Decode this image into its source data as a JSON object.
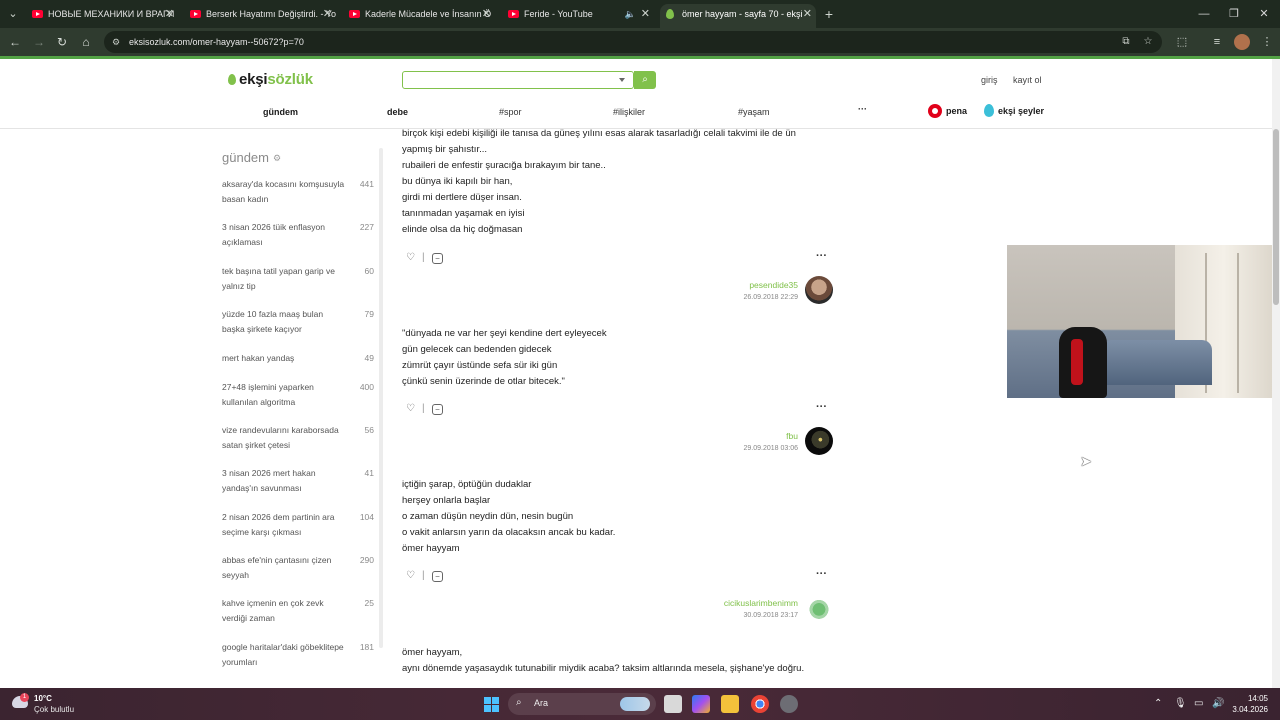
{
  "browser": {
    "tabs": [
      {
        "title": "НОВЫЕ МЕХАНИКИ И ВРАГИ",
        "favicon": "youtube-icon",
        "active": false
      },
      {
        "title": "Berserk Hayatımı Değiştirdi. - Yo",
        "favicon": "youtube-icon",
        "active": false
      },
      {
        "title": "Kaderle Mücadele ve İnsanın Ö",
        "favicon": "youtube-icon",
        "active": false
      },
      {
        "title": "Feride - YouTube",
        "favicon": "youtube-icon",
        "active": false
      },
      {
        "title": "ömer hayyam - sayfa 70 - ekşi",
        "favicon": "eksi-drop-icon",
        "active": true
      }
    ],
    "url": "eksisozluk.com/omer-hayyam--50672?p=70"
  },
  "site": {
    "logo_part1": "ekşi",
    "logo_part2": "sözlük",
    "search_placeholder": "",
    "login": "giriş",
    "register": "kayıt ol",
    "nav": [
      "gündem",
      "debe",
      "#spor",
      "#ilişkiler",
      "#yaşam",
      "···"
    ],
    "pena": "pena",
    "eksi_seyler": "ekşi şeyler",
    "accent_color": "#81c14b"
  },
  "sidebar": {
    "title": "gündem",
    "topics": [
      {
        "title": "aksaray'da kocasını komşusuyla basan kadın",
        "count": "441"
      },
      {
        "title": "3 nisan 2026 tüik enflasyon açıklaması",
        "count": "227"
      },
      {
        "title": "tek başına tatil yapan garip ve yalnız tip",
        "count": "60"
      },
      {
        "title": "yüzde 10 fazla maaş bulan başka şirkete kaçıyor",
        "count": "79"
      },
      {
        "title": "mert hakan yandaş",
        "count": "49"
      },
      {
        "title": "27+48 işlemini yaparken kullanılan algoritma",
        "count": "400"
      },
      {
        "title": "vize randevularını karaborsada satan şirket çetesi",
        "count": "56"
      },
      {
        "title": "3 nisan 2026 mert hakan yandaş'ın savunması",
        "count": "41"
      },
      {
        "title": "2 nisan 2026 dem partinin ara seçime karşı çıkması",
        "count": "104"
      },
      {
        "title": "abbas efe'nin çantasını çizen seyyah",
        "count": "290"
      },
      {
        "title": "kahve içmenin en çok zevk verdiği zaman",
        "count": "25"
      },
      {
        "title": "google haritalar'daki göbeklitepe yorumları",
        "count": "181"
      }
    ]
  },
  "entries": [
    {
      "lines": [
        "birçok kişi edebi kişiliği ile tanısa da güneş yılını esas alarak tasarladığı celali takvimi ile de ün",
        "yapmış bir şahıstır...",
        "rubaileri de enfestir şuracığa bırakayım bir tane..",
        "bu dünya iki kapılı bir han,",
        "girdi mi dertlere düşer insan.",
        "tanınmadan yaşamak en iyisi",
        "elinde olsa da hiç doğmasan"
      ],
      "author": "pesendide35",
      "date": "26.09.2018 22:29"
    },
    {
      "lines": [
        "\"dünyada ne var her şeyi kendine dert eyleyecek",
        "gün gelecek can bedenden gidecek",
        "zümrüt çayır üstünde sefa sür iki gün",
        "çünkü senin üzerinde de otlar bitecek.\""
      ],
      "author": "fbu",
      "date": "29.09.2018 03:06"
    },
    {
      "lines": [
        "içtiğin şarap, öptüğün dudaklar",
        "herşey onlarla başlar",
        "o zaman düşün neydin dün, nesin bugün",
        "o vakit anlarsın yarın da olacaksın ancak bu kadar.",
        "ömer hayyam"
      ],
      "author": "cicikuslarimbenimm",
      "date": "30.09.2018 23:17"
    },
    {
      "lines": [
        "ömer hayyam,",
        "aynı dönemde yaşasaydık tutunabilir miydik acaba? taksim altlarında mesela, şişhane'ye doğru."
      ],
      "author": "",
      "date": ""
    }
  ],
  "taskbar": {
    "temperature": "10°C",
    "weather": "Çok bulutlu",
    "weather_badge": "1",
    "search_label": "Ara",
    "time": "14:05",
    "date": "3.04.2026"
  }
}
